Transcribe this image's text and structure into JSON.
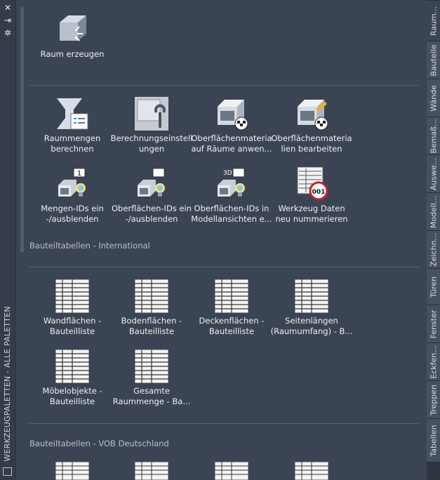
{
  "palette_title": "WERKZEUGPALETTEN - ALLE PALETTEN",
  "groups": {
    "top": {
      "raum_erzeugen": "Raum erzeugen"
    },
    "calc": [
      {
        "l1": "Raummengen",
        "l2": "berechnen"
      },
      {
        "l1": "Berechnungseinstell",
        "l2": "ungen"
      },
      {
        "l1": "Oberflächenmateria",
        "l2": "auf Räume anwen..."
      },
      {
        "l1": "Oberflächenmateria",
        "l2": "lien bearbeiten"
      },
      {
        "l1": "Mengen-IDs ein",
        "l2": "-/ausblenden"
      },
      {
        "l1": "Oberflächen-IDs ein",
        "l2": "-/ausblenden"
      },
      {
        "l1": "Oberflächen-IDs in",
        "l2": "Modellansichten  e..."
      },
      {
        "l1": "Werkzeug Daten",
        "l2": "neu nummerieren"
      }
    ],
    "international": {
      "title": "Bauteiltabellen - International",
      "items": [
        {
          "l1": "Wandflächen -",
          "l2": "Bauteilliste"
        },
        {
          "l1": "Bodenflächen -",
          "l2": "Bauteilliste"
        },
        {
          "l1": "Deckenflächen -",
          "l2": "Bauteilliste"
        },
        {
          "l1": "Seitenlängen",
          "l2": "(Raumumfang)  -  B..."
        },
        {
          "l1": "Möbelobjekte -",
          "l2": "Bauteilliste"
        },
        {
          "l1": "Gesamte",
          "l2": "Raummenge  -  Ba..."
        }
      ]
    },
    "vob": {
      "title": "Bauteiltabellen - VOB Deutschland"
    }
  },
  "badges": {
    "one": "1",
    "three_d": "3D",
    "num": "001"
  },
  "tabs": [
    "Raum...",
    "Bauteile",
    "Wände",
    "Bemaß...",
    "Auswe...",
    "Modell...",
    "Zeichn...",
    "Türen",
    "Fenster",
    "Eckfen...",
    "Treppen",
    "Tabellen"
  ]
}
